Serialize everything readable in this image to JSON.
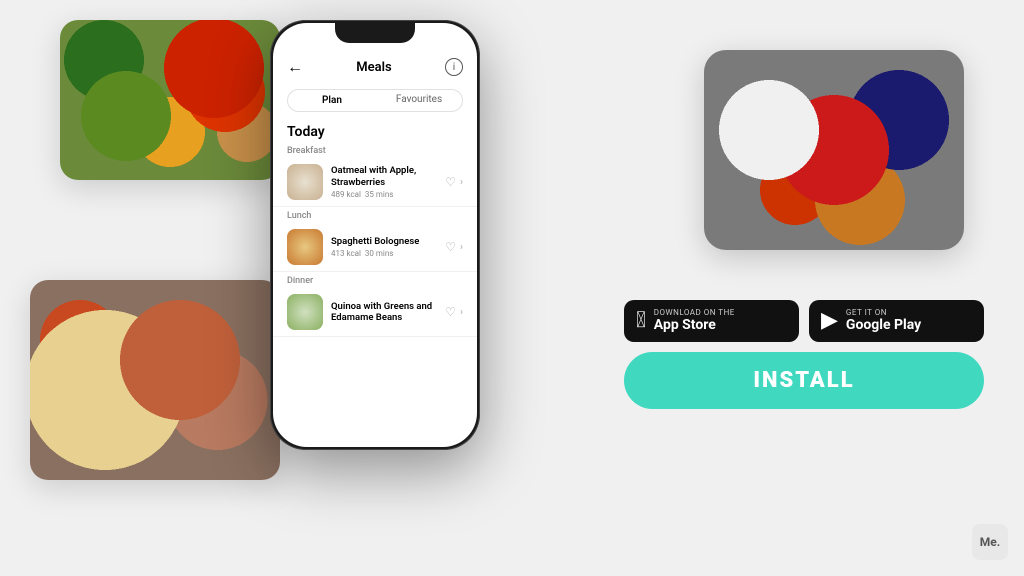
{
  "app": {
    "title": "Meals",
    "tabs": [
      {
        "label": "Plan",
        "active": true
      },
      {
        "label": "Favourites",
        "active": false
      }
    ],
    "section_today": "Today",
    "breakfast_label": "Breakfast",
    "lunch_label": "Lunch",
    "dinner_label": "Dinner",
    "meals": [
      {
        "name": "Oatmeal with Apple, Strawberries",
        "kcal": "489 kcal",
        "time": "35 mins",
        "category": "Breakfast"
      },
      {
        "name": "Spaghetti Bolognese",
        "kcal": "413 kcal",
        "time": "30 mins",
        "category": "Lunch"
      },
      {
        "name": "Quinoa with Greens and Edamame Beans",
        "kcal": "",
        "time": "",
        "category": "Dinner"
      }
    ]
  },
  "cta": {
    "app_store": {
      "subtext": "Download on the",
      "name": "App Store"
    },
    "google_play": {
      "subtext": "GET IT ON",
      "name": "Google Play"
    },
    "install_label": "INSTALL"
  },
  "me_badge": "Me."
}
